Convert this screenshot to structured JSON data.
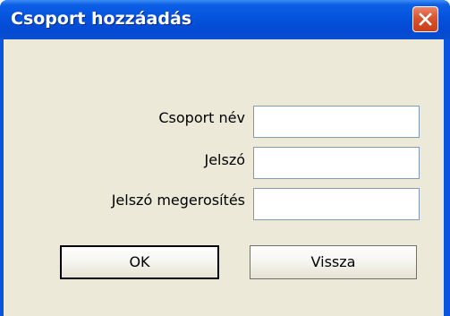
{
  "window": {
    "title": "Csoport hozzáadás"
  },
  "form": {
    "group_name_label": "Csoport név",
    "group_name_value": "",
    "password_label": "Jelszó",
    "password_value": "",
    "password_confirm_label": "Jelszó megerosítés",
    "password_confirm_value": ""
  },
  "buttons": {
    "ok_label": "OK",
    "back_label": "Vissza"
  },
  "icons": {
    "close": "close-icon"
  },
  "colors": {
    "titlebar": "#0553dc",
    "client_background": "#ece9d8",
    "close_button": "#d7532e"
  }
}
